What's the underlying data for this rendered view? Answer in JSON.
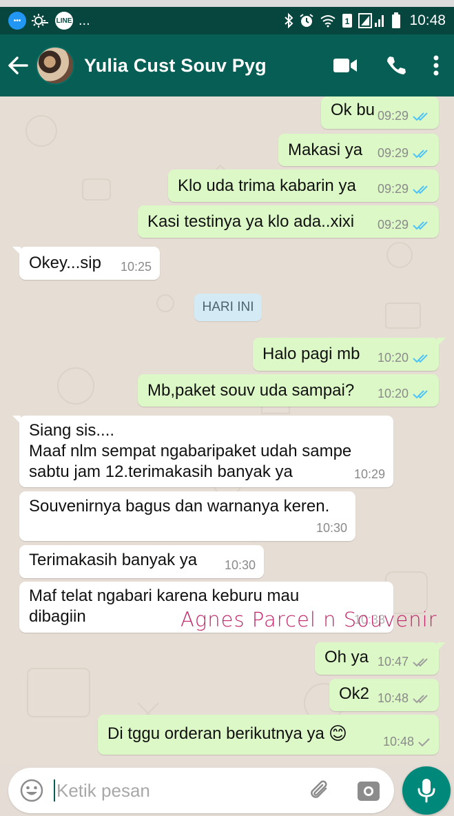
{
  "status_bar": {
    "left_icons": [
      "message-icon",
      "weather-icon",
      "line-app-icon"
    ],
    "line_label": "LINE",
    "ellipsis": "...",
    "right_icons": [
      "bluetooth-icon",
      "alarm-icon",
      "wifi-icon",
      "sim-icon",
      "signal-icon",
      "battery-icon"
    ],
    "time": "10:48"
  },
  "header": {
    "contact_name": "Yulia Cust Souv Pyg",
    "actions": [
      "video-call-icon",
      "voice-call-icon",
      "more-options-icon"
    ]
  },
  "messages": [
    {
      "dir": "out",
      "text": "Ok bu",
      "time": "09:29",
      "status": "read"
    },
    {
      "dir": "out",
      "text": "Makasi ya",
      "time": "09:29",
      "status": "read"
    },
    {
      "dir": "out",
      "text": "Klo uda trima kabarin ya",
      "time": "09:29",
      "status": "read"
    },
    {
      "dir": "out",
      "text": "Kasi testinya ya klo ada..xixi",
      "time": "09:29",
      "status": "read"
    },
    {
      "dir": "in",
      "text": "Okey...sip",
      "time": "10:25"
    },
    {
      "dir": "out",
      "text": "Halo pagi mb",
      "time": "10:20",
      "status": "read"
    },
    {
      "dir": "out",
      "text": "Mb,paket souv uda sampai?",
      "time": "10:20",
      "status": "read"
    },
    {
      "dir": "in",
      "lines": [
        "Siang sis....",
        "Maaf nlm sempat ngabaripaket udah sampe",
        "sabtu jam 12.terimakasih banyak ya"
      ],
      "time": "10:29"
    },
    {
      "dir": "in",
      "text": "Souvenirnya bagus dan warnanya keren.",
      "time": "10:30"
    },
    {
      "dir": "in",
      "text": "Terimakasih banyak ya",
      "time": "10:30"
    },
    {
      "dir": "in",
      "lines": [
        "Maf telat ngabari karena keburu mau",
        "dibagiin"
      ],
      "time": "10:33"
    },
    {
      "dir": "out",
      "text": "Oh ya",
      "time": "10:47",
      "status": "delivered"
    },
    {
      "dir": "out",
      "text": "Ok2",
      "time": "10:48",
      "status": "delivered"
    },
    {
      "dir": "out",
      "text": "Di tggu orderan berikutnya ya",
      "emoji": "😊",
      "time": "10:48",
      "status": "sent"
    }
  ],
  "date_separator": "HARI INI",
  "watermark": "Agnes Parcel n Souvenir",
  "composer": {
    "placeholder": "Ketik pesan",
    "icons": [
      "emoji-icon",
      "attach-icon",
      "camera-icon",
      "mic-icon"
    ]
  },
  "colors": {
    "header": "#075e54",
    "status_bar": "#07463f",
    "outgoing_bubble": "#dcf8c6",
    "incoming_bubble": "#ffffff",
    "read_ticks": "#4fc3f7",
    "watermark": "#c2246a",
    "mic_button": "#00897b"
  }
}
